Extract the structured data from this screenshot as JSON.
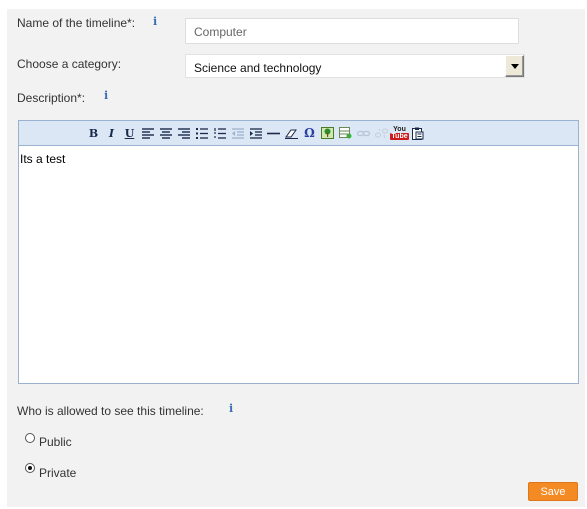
{
  "form": {
    "name_label": "Name of the timeline*:",
    "name_value": "Computer",
    "category_label": "Choose a category:",
    "category_value": "Science and technology",
    "description_label": "Description*:",
    "description_text": "Its a test",
    "visibility_label": "Who is allowed to see this timeline:",
    "visibility_options": [
      {
        "label": "Public",
        "selected": false
      },
      {
        "label": "Private",
        "selected": true
      }
    ],
    "save_label": "Save",
    "info_glyph": "i"
  },
  "toolbar": {
    "buttons": [
      "bold-icon",
      "italic-icon",
      "underline-icon",
      "align-left-icon",
      "align-center-icon",
      "align-right-icon",
      "bullet-list-icon",
      "numbered-list-icon",
      "outdent-icon",
      "indent-icon",
      "horizontal-rule-icon",
      "eraser-icon",
      "special-character-icon",
      "insert-image-icon",
      "insert-table-icon",
      "link-icon",
      "unlink-icon",
      "youtube-icon",
      "paste-icon"
    ],
    "bold_glyph": "B",
    "italic_glyph": "I",
    "underline_glyph": "U",
    "omega_glyph": "Ω",
    "youtube_you": "You",
    "youtube_tube": "Tube"
  },
  "colors": {
    "panel_bg": "#f2f2f2",
    "save_button": "#f48a24",
    "toolbar_bg": "#dce7f5",
    "info_icon": "#3a6fb0"
  }
}
